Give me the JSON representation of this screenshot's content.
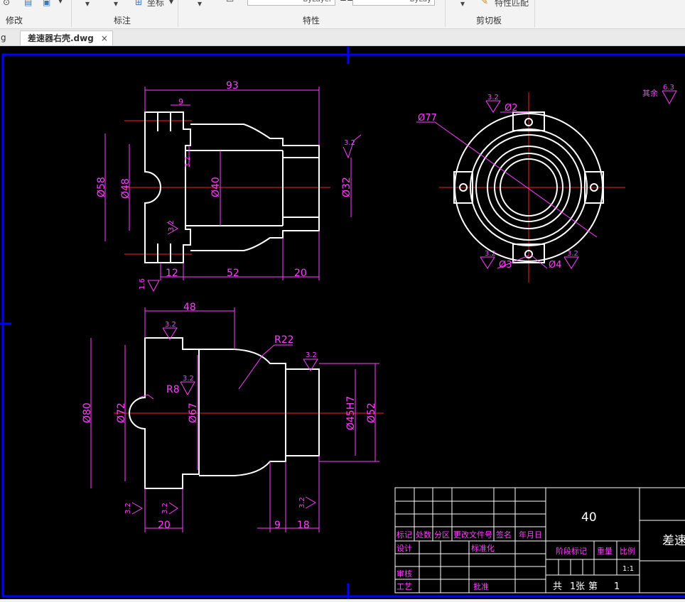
{
  "ribbon": {
    "groups": [
      {
        "label": "修改"
      },
      {
        "label": "标注"
      },
      {
        "label": "特性"
      },
      {
        "label": "剪切板"
      }
    ],
    "coordinate_label": "坐标",
    "match_props_label": "特性匹配",
    "bylayer_1": "ByLayer",
    "bylayer_2": "ByLay"
  },
  "tabs": [
    {
      "label": "g"
    },
    {
      "label": "差速器右壳.dwg",
      "active": true
    }
  ],
  "drawing": {
    "top_view": {
      "d_93": "93",
      "d_9": "9",
      "d_58": "Ø58",
      "d_48": "Ø48",
      "d_40": "Ø40",
      "d_32": "Ø32",
      "d_12": "12",
      "d_52": "52",
      "d_20": "20",
      "r32": "3.2",
      "r16": "1.6"
    },
    "bottom_view": {
      "d_48": "48",
      "r22": "R22",
      "r8": "R8",
      "d_80": "Ø80",
      "d_72": "Ø72",
      "d_67": "Ø67",
      "d_45": "Ø45H7",
      "d_52": "Ø52",
      "d_20": "20",
      "d_9": "9",
      "d_18": "18",
      "r32": "3.2"
    },
    "right_view": {
      "d_77": "Ø77",
      "d_2": "Ø2",
      "d_3": "Ø3",
      "d_4": "Ø4",
      "r32": "3.2",
      "rest_label": "其余",
      "rest_val": "6.3"
    },
    "title_block": {
      "material": "40",
      "part_name": "差速器",
      "row_headers": [
        "标记",
        "处数",
        "分区",
        "更改文件号",
        "签名",
        "年月日"
      ],
      "design": "设计",
      "standard": "标准化",
      "stage_mark": "阶段标记",
      "weight": "重量",
      "scale_label": "比例",
      "scale": "1:1",
      "review": "审核",
      "process": "工艺",
      "approve": "批准",
      "total": "共",
      "sheets_1": "1",
      "zhang": "张",
      "di": "第",
      "sheets_2": "1"
    }
  },
  "colors": {
    "outline": "#ffffff",
    "dimension": "#ff40ff",
    "center": "#ff2020",
    "frame": "#0000ff",
    "background": "#000000"
  }
}
